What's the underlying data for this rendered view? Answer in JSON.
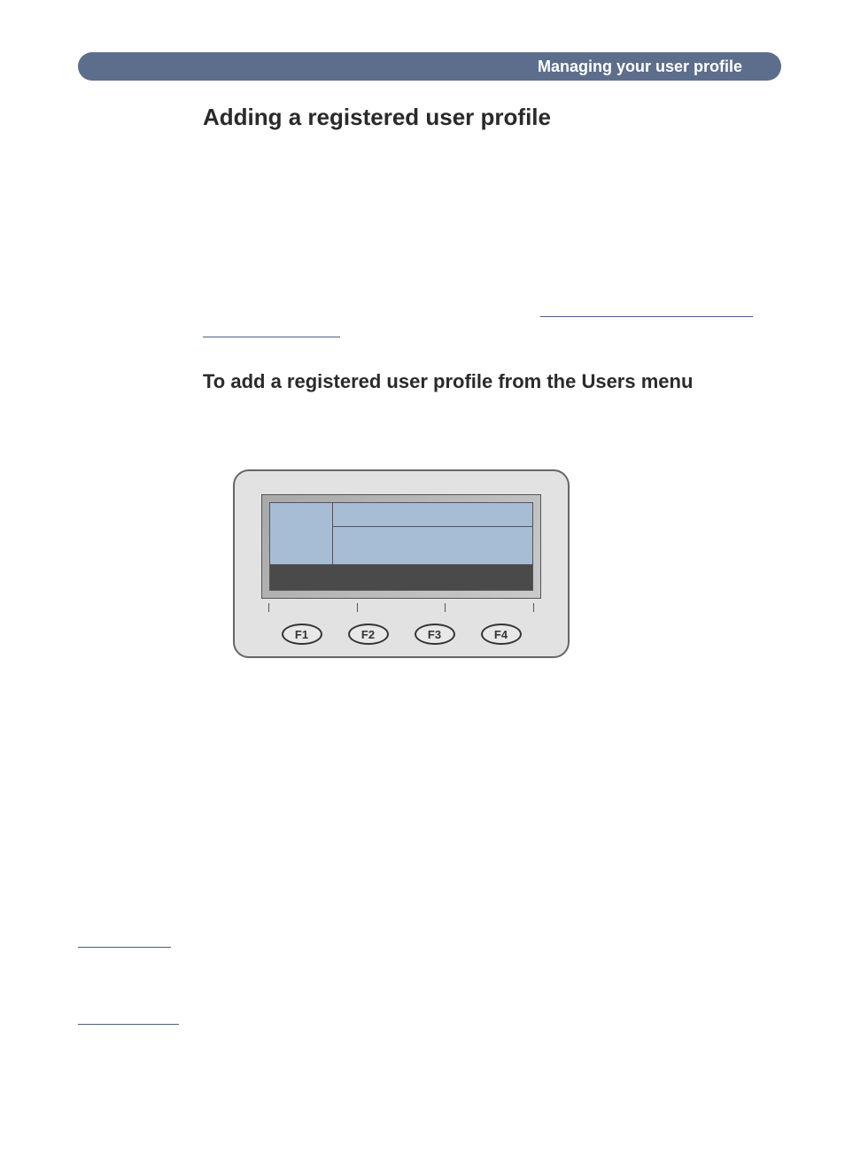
{
  "header": {
    "breadcrumb": "Managing your user profile"
  },
  "title": "Adding a registered user profile",
  "subtitle": "To add a registered user profile from the Users menu",
  "device": {
    "fkeys": [
      "F1",
      "F2",
      "F3",
      "F4"
    ]
  }
}
